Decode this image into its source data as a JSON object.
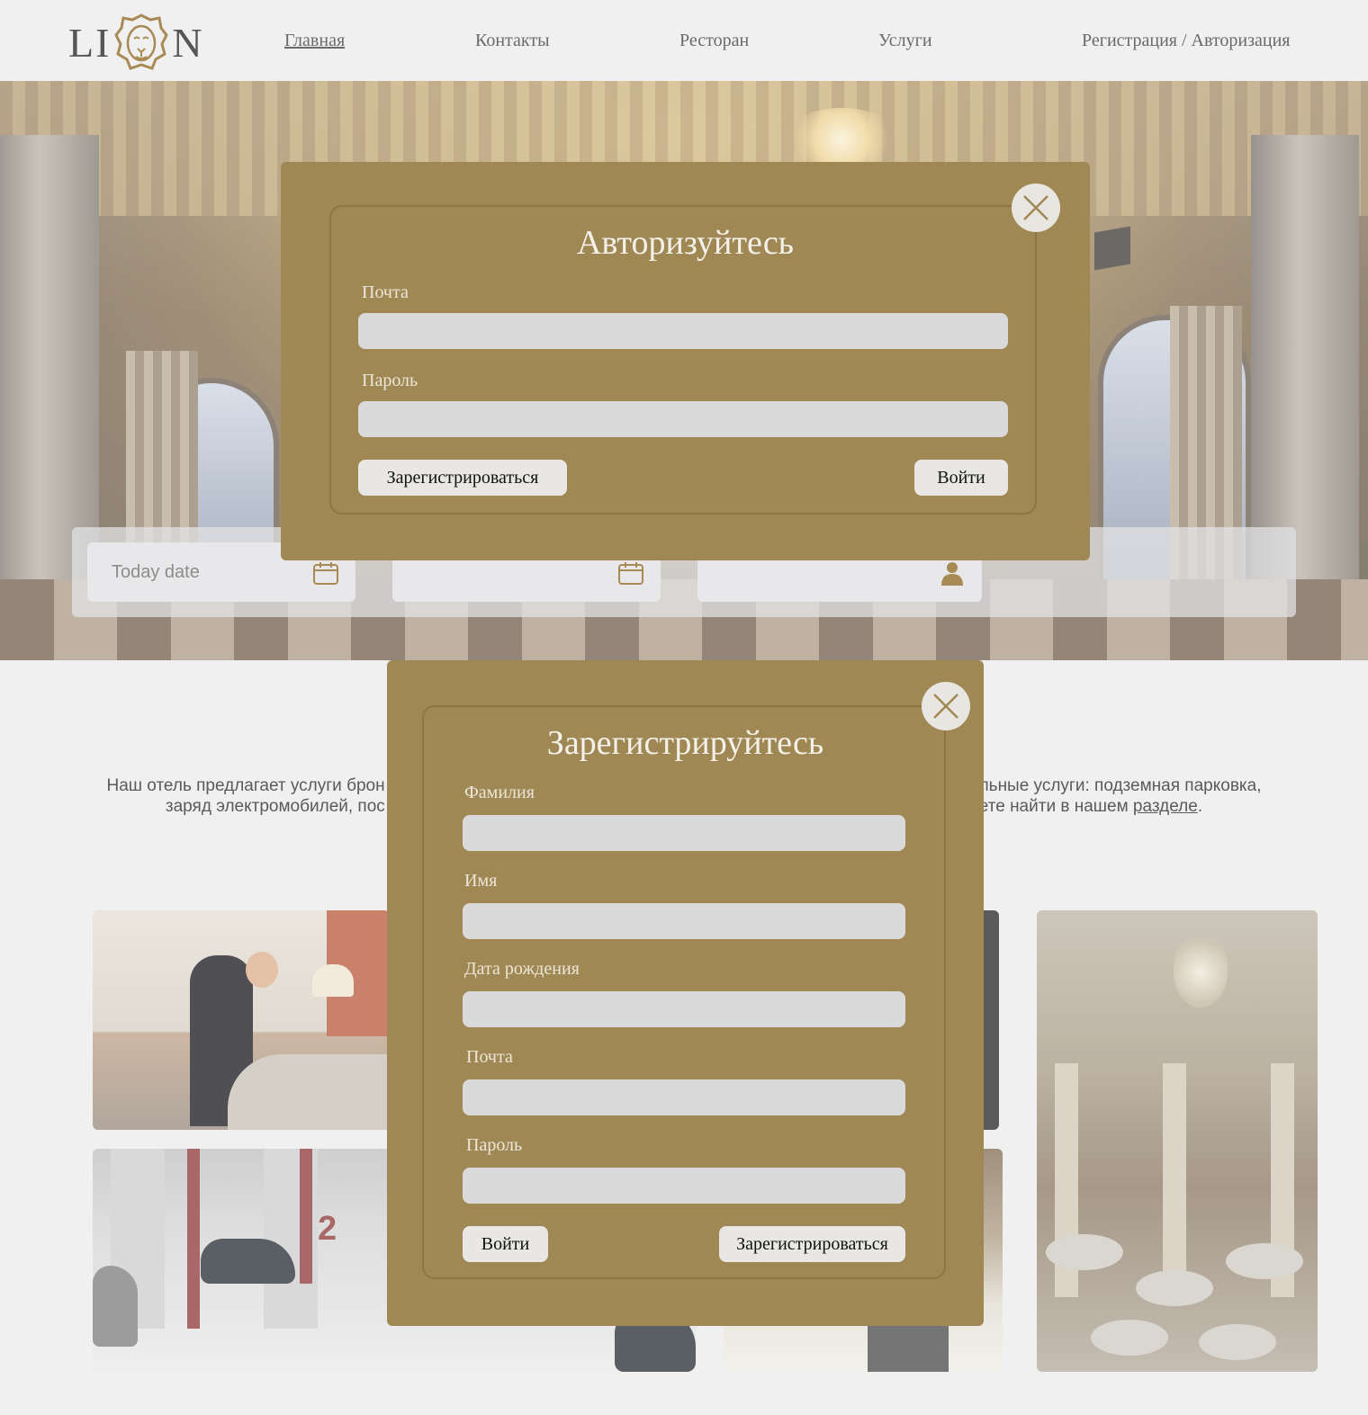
{
  "header": {
    "logo_left": "LI",
    "logo_right": "N",
    "nav": [
      "Главная",
      "Контакты",
      "Ресторан",
      "Услуги",
      "Регистрация / Авторизация"
    ]
  },
  "booking": {
    "date_placeholder": "Today date",
    "icons": [
      "calendar-icon",
      "calendar-icon",
      "user-icon"
    ]
  },
  "intro": {
    "line1_start": "Наш отель предлагает услуги брон",
    "line1_end": "льные услуги: подземная парковка,",
    "line2_start": "заряд электромобилей, пос",
    "line2_end": "ете найти в нашем",
    "link": "разделе",
    "period": "."
  },
  "login_modal": {
    "title": "Авторизуйтесь",
    "fields": [
      {
        "label": "Почта",
        "value": ""
      },
      {
        "label": "Пароль",
        "value": ""
      }
    ],
    "register_button": "Зарегистрироваться",
    "login_button": "Войти"
  },
  "register_modal": {
    "title": "Зарегистрируйтесь",
    "fields": [
      {
        "label": "Фамилия",
        "value": ""
      },
      {
        "label": "Имя",
        "value": ""
      },
      {
        "label": "Дата рождения",
        "value": ""
      },
      {
        "label": "Почта",
        "value": ""
      },
      {
        "label": "Пароль",
        "value": ""
      }
    ],
    "login_button": "Войти",
    "register_button": "Зарегистрироваться"
  },
  "colors": {
    "modal_bg": "#a08855",
    "page_bg": "#f0f0f0",
    "input_bg": "#dadada",
    "brand_gold": "#a88a55"
  },
  "photos": {
    "parking_sign": "2"
  }
}
